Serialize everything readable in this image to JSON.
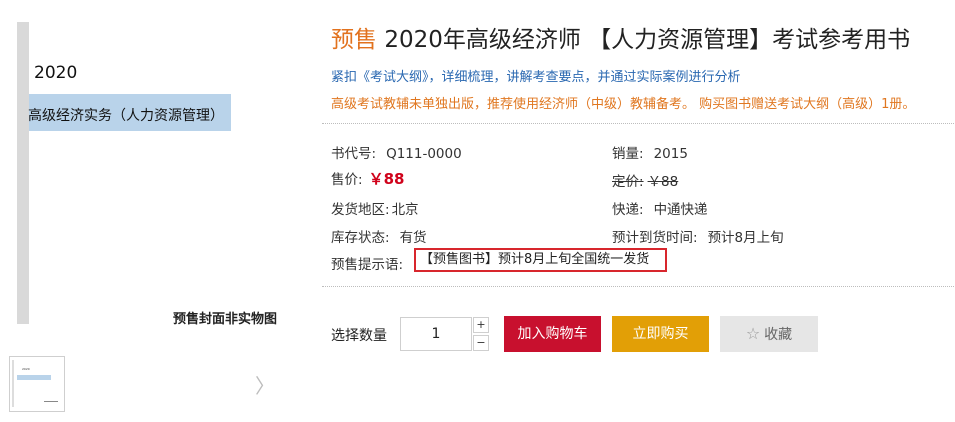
{
  "cover": {
    "year": "2020",
    "title": "高级经济实务（人力资源管理）",
    "note": "预售封面非实物图"
  },
  "gallery": {
    "next_icon": "chevron-right-icon",
    "next_glyph": "〉"
  },
  "product": {
    "title_prefix": "预售",
    "title": "2020年高级经济师 【人力资源管理】考试参考用书",
    "desc_blue": "紧扣《考试大纲》，详细梳理，讲解考查要点，并通过实际案例进行分析",
    "desc_orange": "高级考试教辅未单独出版，推荐使用经济师（中级）教辅备考。 购买图书赠送考试大纲（高级）1册。"
  },
  "info": {
    "code_label": "书代号:",
    "code_value": "Q111-0000",
    "sales_label": "销量:",
    "sales_value": "2015",
    "price_label": "售价:",
    "price_value": "￥88",
    "list_price_label": "定价:",
    "list_price_value": "￥88",
    "ship_from_label": "发货地区:",
    "ship_from_value": "北京",
    "courier_label": "快递:",
    "courier_value": "中通快递",
    "stock_label": "库存状态:",
    "stock_value": "有货",
    "arrival_label": "预计到货时间:",
    "arrival_value": "预计8月上旬",
    "hint_label": "预售提示语:",
    "hint_value": "【预售图书】预计8月上旬全国统一发货"
  },
  "purchase": {
    "qty_label": "选择数量",
    "qty_value": "1",
    "plus": "+",
    "minus": "−",
    "add_cart": "加入购物车",
    "buy_now": "立即购买",
    "favorite": "收藏",
    "favorite_icon": "star-icon"
  },
  "colors": {
    "presale": "#e2721e",
    "blue_text": "#2a68b1",
    "orange_text": "#e07720",
    "price_red": "#d0021b",
    "cart_button": "#c8102e",
    "buy_button": "#e29f06",
    "hint_border": "#d8262d"
  }
}
